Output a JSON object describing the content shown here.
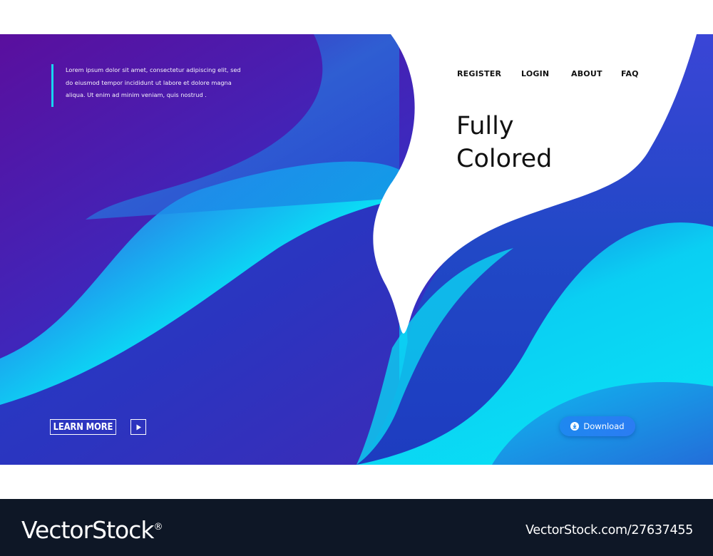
{
  "intro": {
    "text": "Lorem ipsum dolor sit amet, consectetur adipiscing elit, sed do eiusmod tempor incididunt ut labore et dolore magna aliqua. Ut enim ad minim veniam, quis nostrud ."
  },
  "nav": {
    "register": "REGISTER",
    "login": "LOGIN",
    "about": "ABOUT",
    "faq": "FAQ"
  },
  "hero": {
    "title_line1": "Fully",
    "title_line2": "Colored"
  },
  "cta": {
    "learn_more": "LEARN MORE",
    "play_icon": "play-icon",
    "download": "Download",
    "download_icon": "download-icon"
  },
  "watermark": {
    "logo": "VectorStock",
    "registered": "®",
    "id": "VectorStock.com/27637455"
  },
  "colors": {
    "deep_purple": "#5a0f9e",
    "royal_blue": "#2a3ac8",
    "cyan": "#0ae4f5",
    "text_dark": "#111111",
    "footer_bg": "#0e1726",
    "download_button": "#1e88f0"
  }
}
